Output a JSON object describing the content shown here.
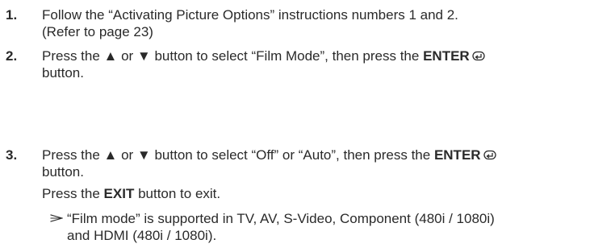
{
  "steps": [
    {
      "number": "1.",
      "line1": "Follow the “Activating Picture Options” instructions numbers 1 and 2.",
      "line2": "(Refer to page 23)"
    },
    {
      "number": "2.",
      "line1_pre": "Press the ▲ or ▼ button to select “Film Mode”, then press the ",
      "line1_bold": "ENTER",
      "line2": "button."
    },
    {
      "number": "3.",
      "line1_pre": "Press the ▲ or ▼ button to select “Off” or “Auto”, then press the ",
      "line1_bold": "ENTER",
      "line2": "button.",
      "exit_pre": "Press the ",
      "exit_bold": "EXIT",
      "exit_post": " button to exit."
    }
  ],
  "note": {
    "icon": "note-arrow-icon",
    "line1": "“Film mode” is supported in TV, AV, S-Video, Component (480i / 1080i)",
    "line2": "and HDMI (480i / 1080i)."
  }
}
